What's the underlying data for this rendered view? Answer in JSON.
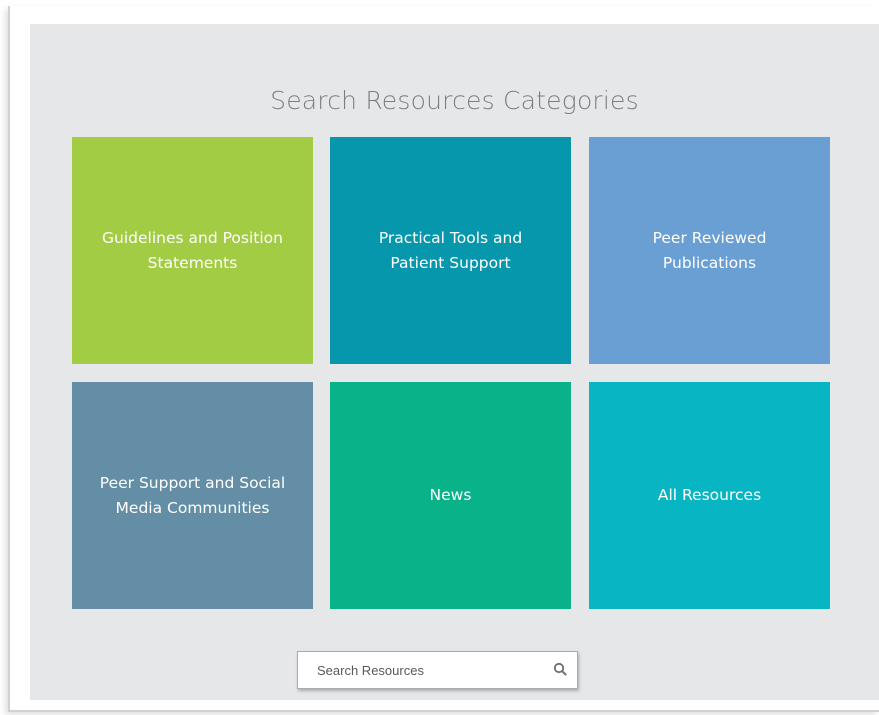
{
  "page": {
    "title": "Search Resources Categories"
  },
  "categories": [
    {
      "label": "Guidelines and Position Statements",
      "color": "#a3cc45"
    },
    {
      "label": "Practical Tools and Patient Support",
      "color": "#0797ad"
    },
    {
      "label": "Peer Reviewed Publications",
      "color": "#6a9fd4"
    },
    {
      "label": "Peer Support and Social Media Communities",
      "color": "#648ea5"
    },
    {
      "label": "News",
      "color": "#0ab289"
    },
    {
      "label": "All Resources",
      "color": "#08b5c2"
    }
  ],
  "search": {
    "placeholder": "Search Resources",
    "value": "",
    "icon": "search-icon"
  },
  "colors": {
    "panel_background": "#e6e7e9",
    "title_text": "#7b7e82"
  }
}
